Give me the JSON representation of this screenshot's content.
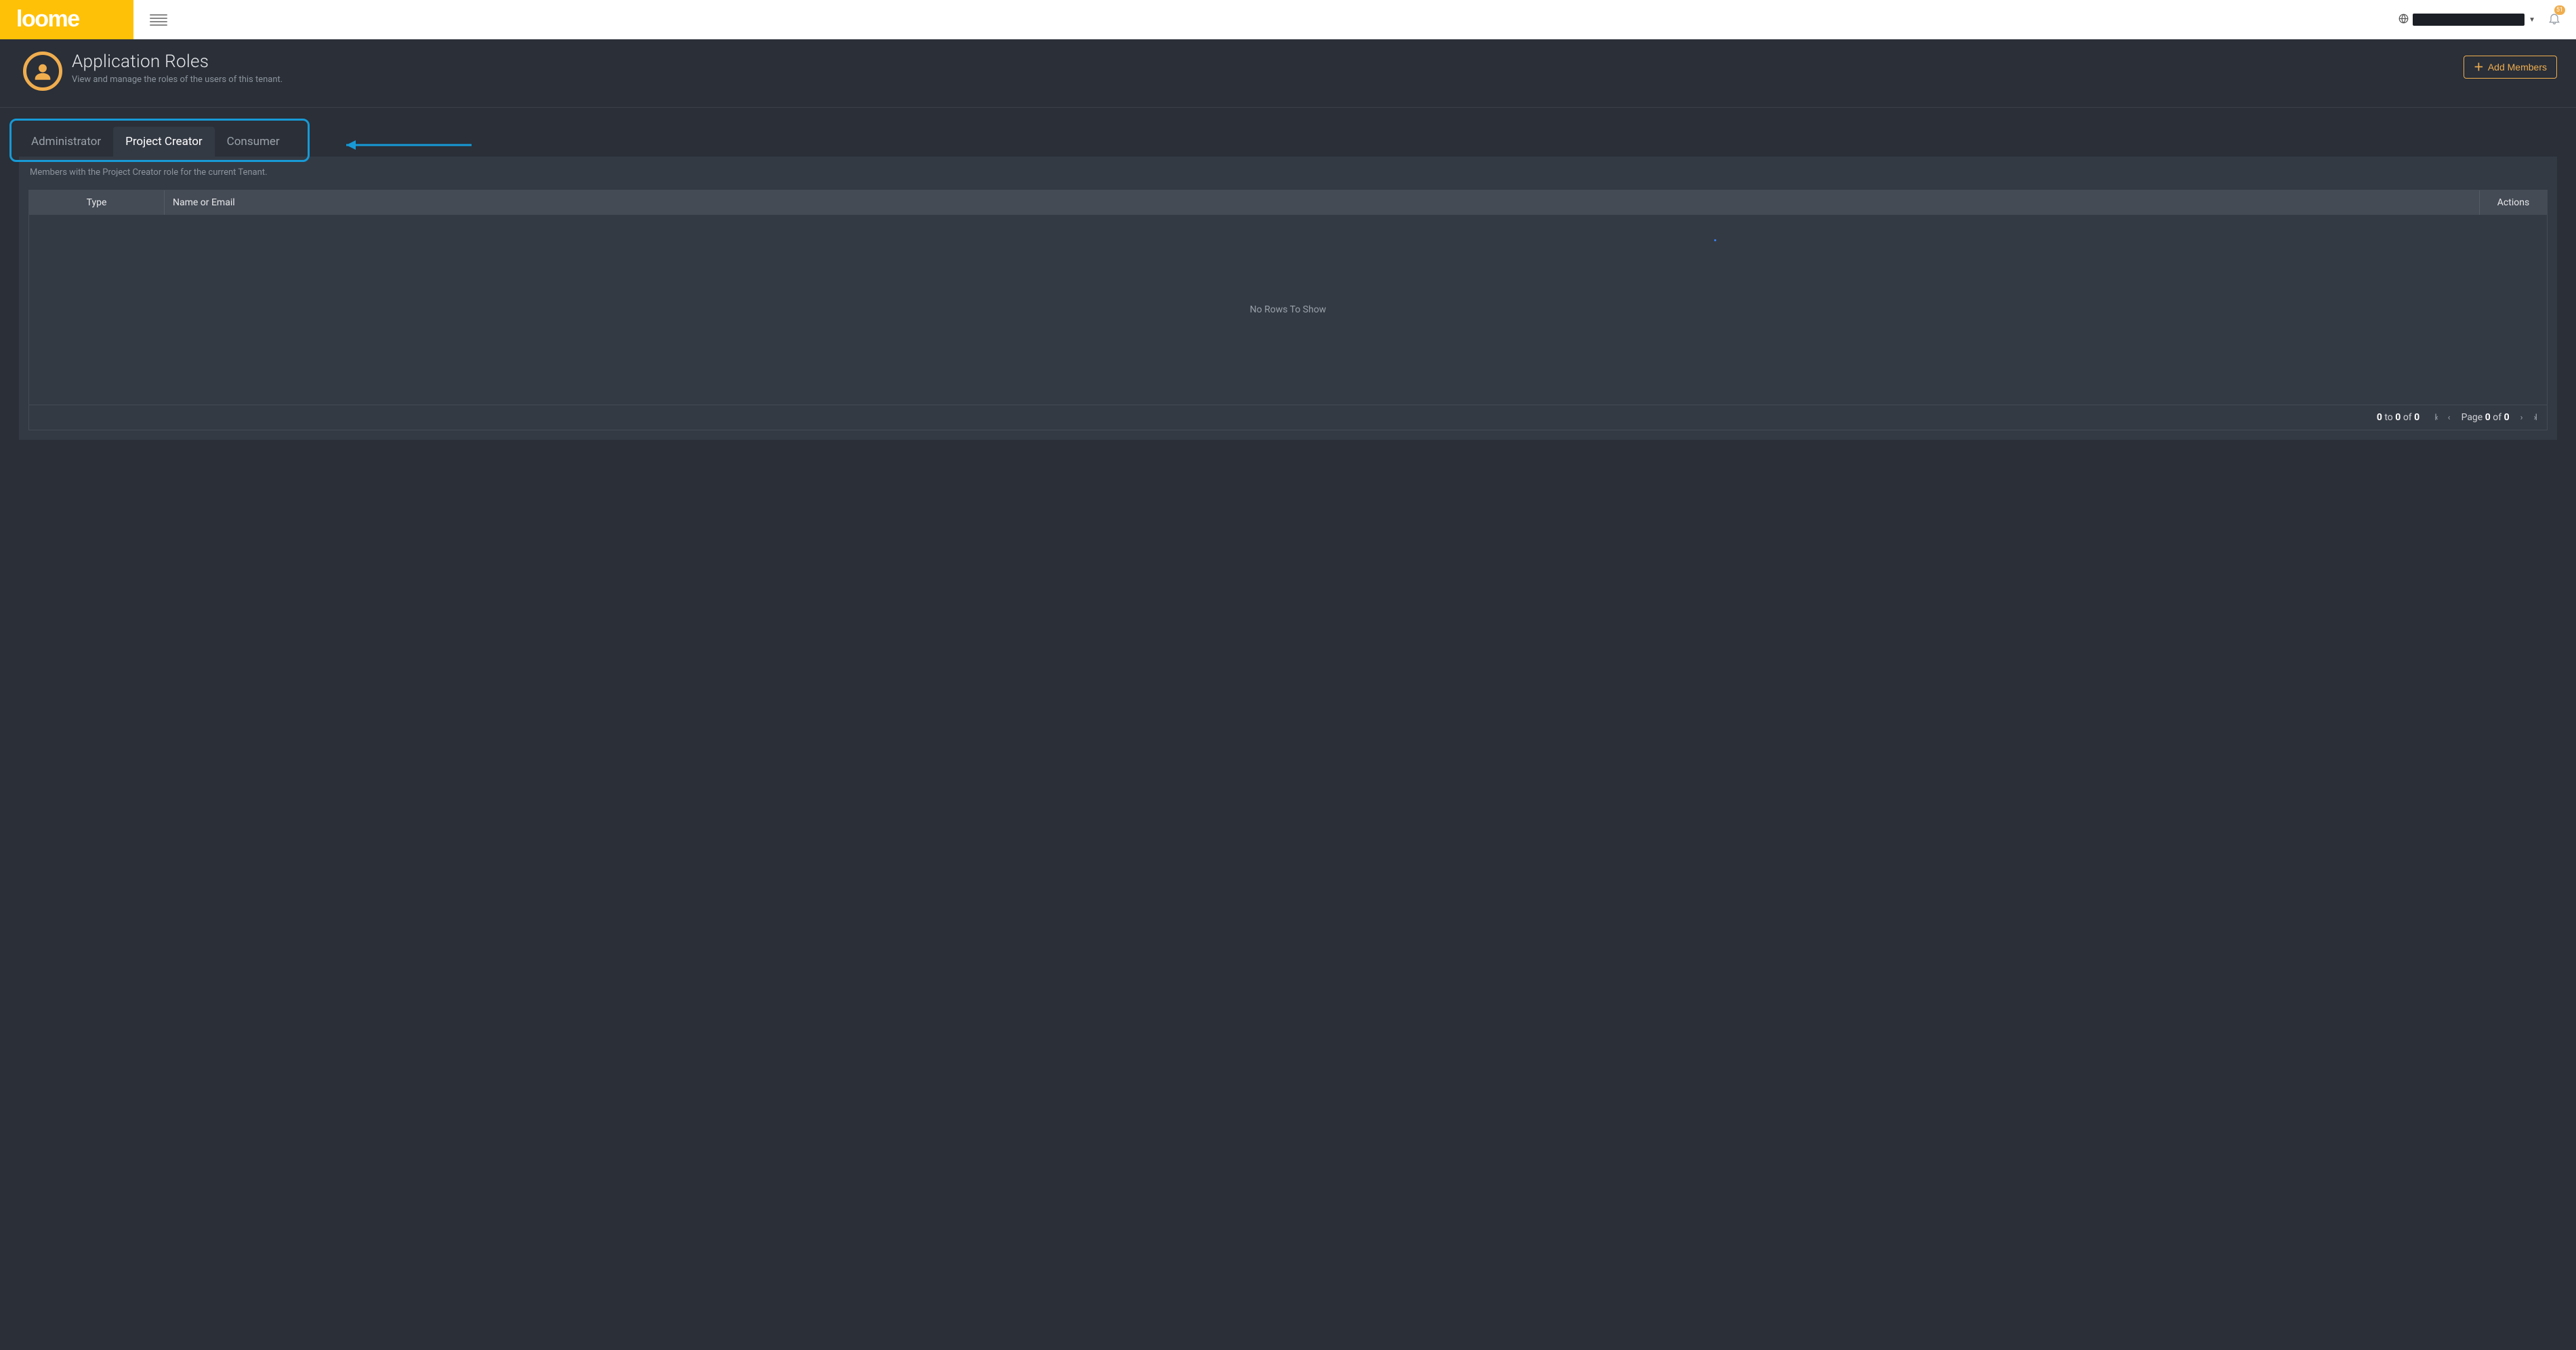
{
  "brand": {
    "name": "loome"
  },
  "topbar": {
    "notification_count": "51"
  },
  "header": {
    "title": "Application Roles",
    "subtitle": "View and manage the roles of the users of this tenant.",
    "add_members_label": "Add Members"
  },
  "tabs": [
    {
      "key": "administrator",
      "label": "Administrator",
      "active": false
    },
    {
      "key": "project-creator",
      "label": "Project Creator",
      "active": true
    },
    {
      "key": "consumer",
      "label": "Consumer",
      "active": false
    }
  ],
  "panel": {
    "description": "Members with the Project Creator role for the current Tenant."
  },
  "grid": {
    "columns": {
      "type": "Type",
      "name": "Name or Email",
      "actions": "Actions"
    },
    "empty_text": "No Rows To Show",
    "footer": {
      "from": "0",
      "to": "0",
      "total": "0",
      "to_word": "to",
      "of_word": "of",
      "page_word": "Page",
      "page_current": "0",
      "page_total": "0"
    }
  }
}
